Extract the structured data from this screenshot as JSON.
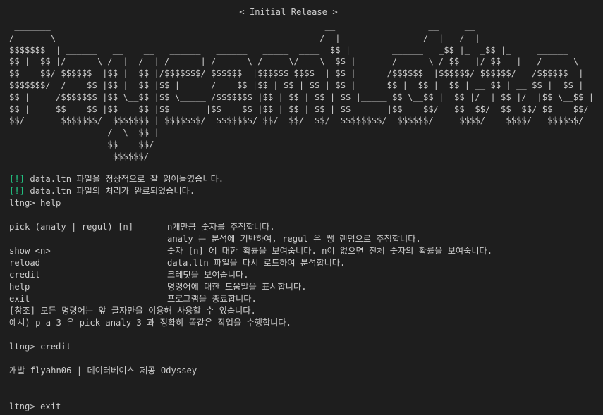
{
  "title": "< Initial Release >",
  "ascii_art": [
    " _______                                                     __                  __     __",
    "/       \\                                                   /  |                /  |   /  |",
    "$$$$$$$  | ______   __    __   ______   ______   _____  ____  $$ |        ______   _$$ |_  _$$ |_     ______",
    "$$ |__$$ |/      \\ /  |  /  | /      | /      \\ /     \\/    \\  $$ |       /      \\ / $$   |/ $$   |   /      \\",
    "$$    $$/ $$$$$$  |$$ |  $$ |/$$$$$$$/ $$$$$$  |$$$$$$ $$$$  | $$ |      /$$$$$$  |$$$$$$/ $$$$$$/   /$$$$$$  |",
    "$$$$$$$/  /    $$ |$$ |  $$ |$$ |      /    $$ |$$ | $$ | $$ | $$ |      $$ |  $$ |  $$ | __ $$ | __ $$ |  $$ |",
    "$$ |     /$$$$$$$ |$$ \\__$$ |$$ \\_____ /$$$$$$$ |$$ | $$ | $$ | $$ |_____ $$ \\__$$ |  $$ |/  | $$ |/  |$$ \\__$$ |",
    "$$ |     $$    $$ |$$    $$ |$$       |$$    $$ |$$ | $$ | $$ | $$       |$$    $$/   $$  $$/  $$  $$/ $$    $$/",
    "$$/       $$$$$$$/  $$$$$$$ | $$$$$$$/  $$$$$$$/ $$/  $$/  $$/  $$$$$$$$/  $$$$$$/     $$$$/    $$$$/   $$$$$$/",
    "                   /  \\__$$ |",
    "                   $$    $$/",
    "                    $$$$$$/"
  ],
  "messages": [
    {
      "tag": "[!]",
      "text": " data.ltn 파일을 정상적으로 잘 읽어들였습니다."
    },
    {
      "tag": "[!]",
      "text": " data.ltn 파일의 처리가 완료되었습니다."
    }
  ],
  "prompt": "ltng> ",
  "first_input": "help",
  "help_rows": [
    {
      "cmd": "pick (analy | regul) [n]",
      "desc": "n개만큼 숫자를 추첨합니다."
    },
    {
      "cmd": "",
      "desc": "analy 는 분석에 기반하여, regul 은 쌩 랜덤으로 추첨합니다."
    },
    {
      "cmd": "show <n>",
      "desc": "숫자 [n] 에 대한 확률을 보여줍니다. n이 없으면 전체 숫자의 확률을 보여줍니다."
    },
    {
      "cmd": "reload",
      "desc": "data.ltn 파일을 다시 로드하여 분석합니다."
    },
    {
      "cmd": "credit",
      "desc": "크레딧을 보여줍니다."
    },
    {
      "cmd": "help",
      "desc": "명령어에 대한 도움말을 표시합니다."
    },
    {
      "cmd": "exit",
      "desc": "프로그램을 종료합니다."
    }
  ],
  "note1": "[참조] 모든 명령어는 앞 글자만을 이용해 사용할 수 있습니다.",
  "note2": "예시) p a 3 은 pick analy 3 과 정확히 똑같은 작업을 수행합니다.",
  "second_input": "credit",
  "credit_text": "개발 flyahn06 | 데이터베이스 제공 Odyssey",
  "third_input": "exit",
  "colors": {
    "background": "#1e1e1e",
    "text": "#cccccc",
    "accent": "#23d18b"
  }
}
